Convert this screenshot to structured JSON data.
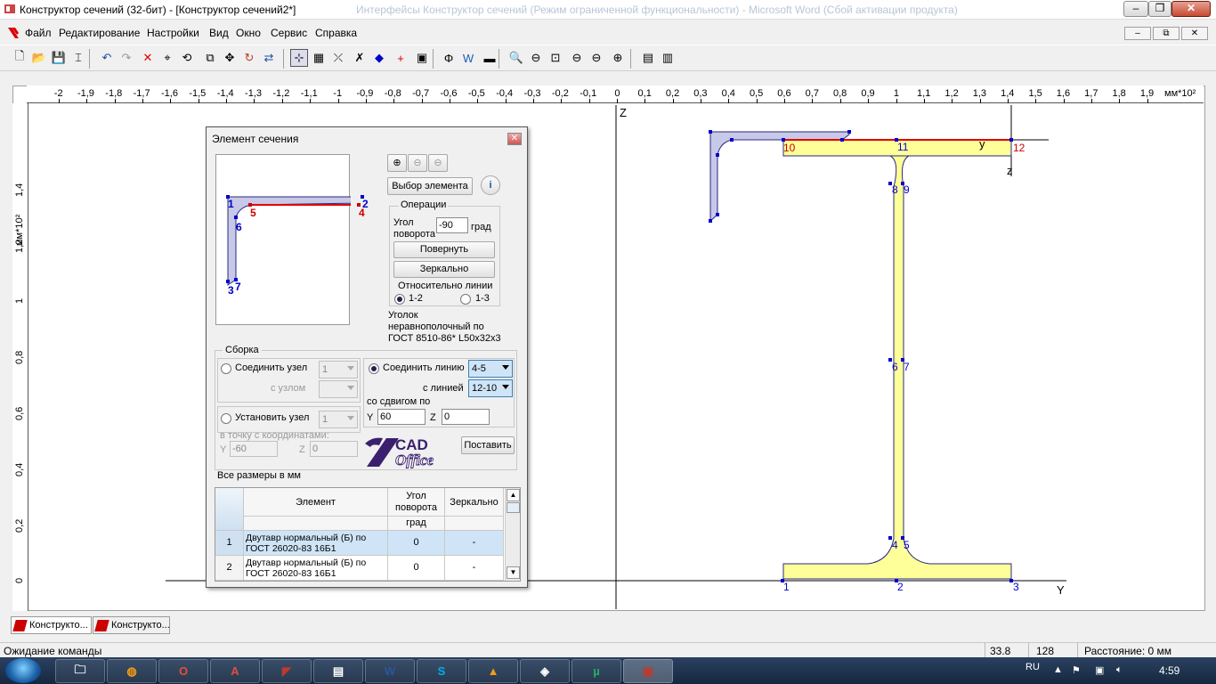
{
  "window": {
    "title": "Конструктор сечений (32-бит) - [Конструктор сечений2*]",
    "title_behind": "Интерфейсы Конструктор сечений (Режим ограниченной функциональности) - Microsoft Word (Сбой активации продукта)",
    "minimize": "‒",
    "maximize": "❐",
    "close": "✕"
  },
  "menu": [
    "Файл",
    "Редактирование",
    "Настройки",
    "Вид",
    "Окно",
    "Сервис",
    "Справка"
  ],
  "mdi_controls": {
    "minimize": "–",
    "restore": "⧉",
    "close": "✕"
  },
  "toolbar": {
    "icons": [
      "new-icon",
      "open-icon",
      "save-icon",
      "properties-icon",
      "undo-icon",
      "redo-icon",
      "delete-icon",
      "node-icon",
      "rotate-group-icon",
      "copy-icon",
      "move-icon",
      "rotate-icon",
      "mirror-icon",
      "snap-grid-icon",
      "grid-icon",
      "dimension-icon",
      "delete-node-icon",
      "point-icon",
      "add-element-icon",
      "library-icon",
      "stress-icon",
      "word-report-icon",
      "palette-icon",
      "zoom-in-icon",
      "zoom-out-icon",
      "zoom-window-icon",
      "zoom-previous-icon",
      "zoom-next-icon",
      "zoom-all-icon",
      "calculate-icon",
      "results-icon"
    ],
    "glyphs": [
      "🗋",
      "📂",
      "💾",
      "⌶",
      "↶",
      "↷",
      "✕",
      "⌖",
      "⟲",
      "⧉",
      "✥",
      "↻",
      "⇄",
      "⊹",
      "▦",
      "⤫",
      "✗",
      "◆",
      "+",
      "▣",
      "Φ",
      "W",
      "▬",
      "🔍",
      "⊖",
      "⊡",
      "⊖",
      "⊖",
      "⊕",
      "▤",
      "▥"
    ]
  },
  "ruler": {
    "x_ticks": [
      "-2",
      "-1,9",
      "-1,8",
      "-1,7",
      "-1,6",
      "-1,5",
      "-1,4",
      "-1,3",
      "-1,2",
      "-1,1",
      "-1",
      "-0,9",
      "-0,8",
      "-0,7",
      "-0,6",
      "-0,5",
      "-0,4",
      "-0,3",
      "-0,2",
      "-0,1",
      "0",
      "0,1",
      "0,2",
      "0,3",
      "0,4",
      "0,5",
      "0,6",
      "0,7",
      "0,8",
      "0,9",
      "1",
      "1,1",
      "1,2",
      "1,3",
      "1,4",
      "1,5",
      "1,6",
      "1,7",
      "1,8",
      "1,9"
    ],
    "x_unit": "мм*10²",
    "y_ticks": [
      "1,4",
      "1,2",
      "1",
      "0,8",
      "0,6",
      "0,4",
      "0,2",
      "0"
    ],
    "y_unit": "мм*10²"
  },
  "canvas": {
    "axis_z": "Z",
    "axis_y": "Y",
    "local_y": "y",
    "local_z": "z",
    "ibeam_nodes_blue": [
      "1",
      "2",
      "3",
      "4",
      "5",
      "6",
      "7",
      "8",
      "9",
      "11"
    ],
    "ibeam_nodes_red": [
      "10",
      "12"
    ],
    "colors": {
      "ibeam_fill": "#ffff99",
      "angle_fill": "#c8c8e8",
      "outline": "#2a2a80",
      "join_line": "#e00000",
      "node": "#0000cc"
    }
  },
  "dialog": {
    "title": "Элемент сечения",
    "close": "✕",
    "preview_nodes": [
      "1",
      "2",
      "3",
      "4",
      "5",
      "6",
      "7"
    ],
    "select_element": "Выбор элемента",
    "info_icon": "i",
    "operations": {
      "title": "Операции",
      "angle_label_1": "Угол",
      "angle_label_2": "поворота",
      "angle_value": "-90",
      "angle_unit": "град",
      "rotate": "Повернуть",
      "mirror": "Зеркально",
      "relative_line": "Относительно линии",
      "opt_12": "1-2",
      "opt_13": "1-3"
    },
    "element_desc": [
      "Уголок",
      "неравнополочный по",
      "ГОСТ 8510-86* L50x32x3"
    ],
    "assembly": {
      "title": "Сборка",
      "join_node": "Соединить узел",
      "join_node_val": "1",
      "with_node": "с узлом",
      "with_node_val": "",
      "set_node": "Установить узел",
      "set_node_val": "1",
      "to_point": "в точку с координатами:",
      "y_label": "Y",
      "y_val": "-60",
      "z_label": "Z",
      "z_val": "0",
      "join_line": "Соединить линию",
      "join_line_val": "4-5",
      "with_line": "с линией",
      "with_line_val": "12-10",
      "shift_label": "со сдвигом по",
      "shift_y_label": "Y",
      "shift_y": "60",
      "shift_z_label": "Z",
      "shift_z": "0",
      "place": "Поставить"
    },
    "logo": {
      "top": "CAD",
      "bottom": "Office"
    },
    "units_note": "Все размеры в мм",
    "table": {
      "headers": [
        "Элемент",
        "Угол поворота",
        "Зеркально"
      ],
      "subheader": "град",
      "rows": [
        {
          "num": "1",
          "element": "Двутавр нормальный (Б) по ГОСТ 26020-83  16Б1",
          "angle": "0",
          "mirror": "-"
        },
        {
          "num": "2",
          "element": "Двутавр нормальный (Б) по ГОСТ 26020-83  16Б1",
          "angle": "0",
          "mirror": "-"
        }
      ]
    }
  },
  "tabs": [
    "Конструкто...",
    "Конструкто..."
  ],
  "status": {
    "text": "Ожидание команды",
    "v1": "33.8",
    "v2": "128",
    "distance": "Расстояние: 0 мм"
  },
  "taskbar": {
    "apps": [
      "folder-icon",
      "firefox-icon",
      "opera-icon",
      "acrobat-icon",
      "scad-icon",
      "archive-icon",
      "word-icon",
      "skype-icon",
      "vlc-icon",
      "network-icon",
      "utorrent-icon",
      "constructor-icon"
    ],
    "lang": "RU",
    "time": "4:59"
  }
}
